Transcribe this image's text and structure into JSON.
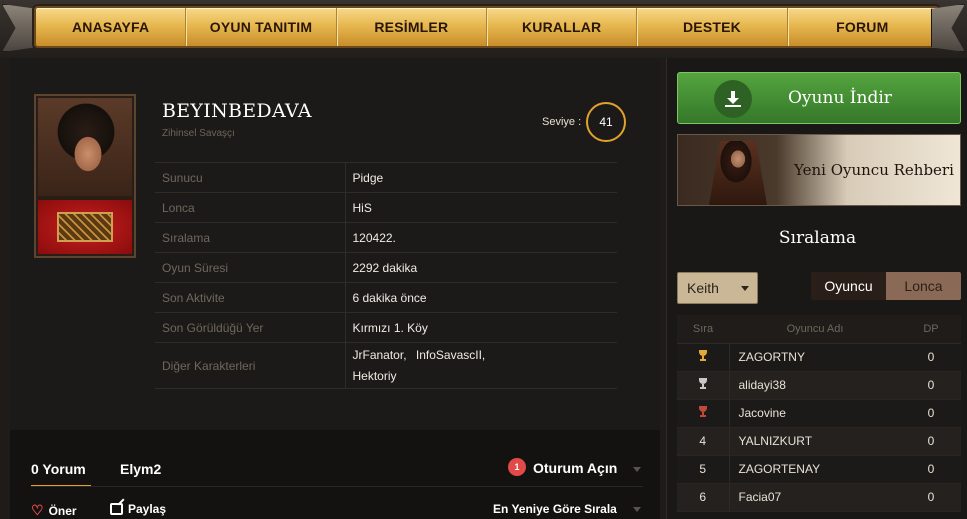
{
  "nav": {
    "items": [
      "ANASAYFA",
      "OYUN TANITIM",
      "RESİMLER",
      "KURALLAR",
      "DESTEK",
      "FORUM"
    ]
  },
  "profile": {
    "name": "BEYINBEDAVA",
    "class": "Zihinsel Savaşçı",
    "level_label": "Seviye :",
    "level": "41",
    "fields": [
      {
        "key": "Sunucu",
        "value": "Pidge"
      },
      {
        "key": "Lonca",
        "value": "HiS"
      },
      {
        "key": "Sıralama",
        "value": "120422."
      },
      {
        "key": "Oyun Süresi",
        "value": "2292 dakika"
      },
      {
        "key": "Son Aktivite",
        "value": "6 dakika önce"
      },
      {
        "key": "Son Görüldüğü Yer",
        "value": "Kırmızı 1. Köy"
      }
    ],
    "other_chars_label": "Diğer Karakterleri",
    "other_chars": [
      "JrFanator,",
      "InfoSavascII,",
      "Hektoriy"
    ]
  },
  "comments": {
    "count_label": "0 Yorum",
    "tab_name": "Elym2",
    "login_badge": "1",
    "login_label": "Oturum Açın",
    "recommend_label": "Öner",
    "share_label": "Paylaş",
    "sort_label": "En Yeniye Göre Sırala"
  },
  "sidebar": {
    "download_label": "Oyunu İndir",
    "guide_label": "Yeni Oyuncu Rehberi",
    "ranking_title": "Sıralama",
    "server_selected": "Keith",
    "toggle": [
      "Oyuncu",
      "Lonca"
    ],
    "table_headers": [
      "Sıra",
      "Oyuncu Adı",
      "DP"
    ],
    "rows": [
      {
        "rank": "",
        "trophy": "gold-trophy-icon",
        "name": "ZAGORTNY",
        "dp": "0"
      },
      {
        "rank": "",
        "trophy": "silver-trophy-icon",
        "name": "alidayi38",
        "dp": "0"
      },
      {
        "rank": "",
        "trophy": "bronze-trophy-icon",
        "name": "Jacovine",
        "dp": "0"
      },
      {
        "rank": "4",
        "trophy": "",
        "name": "YALNIZKURT",
        "dp": "0"
      },
      {
        "rank": "5",
        "trophy": "",
        "name": "ZAGORTENAY",
        "dp": "0"
      },
      {
        "rank": "6",
        "trophy": "",
        "name": "Facia07",
        "dp": "0"
      }
    ]
  },
  "colors": {
    "accent": "#e0a22c",
    "download_green": "#4a9438",
    "nav_gold": "#e7b850",
    "badge_red": "#e24a4a"
  }
}
